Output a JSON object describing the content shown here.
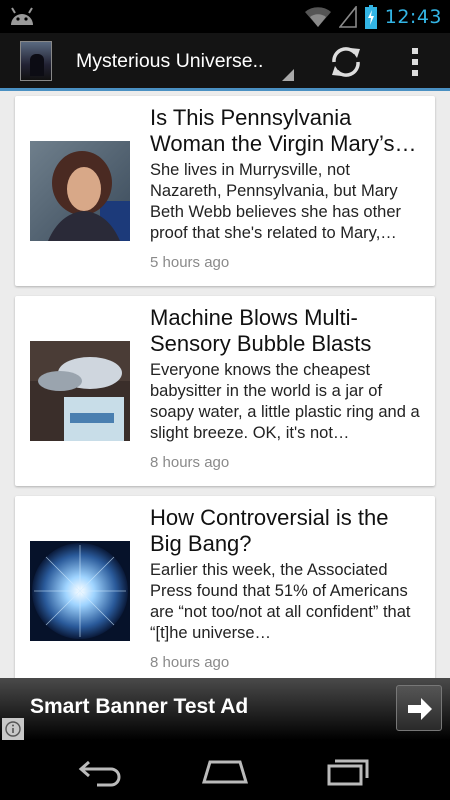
{
  "status_bar": {
    "time": "12:43",
    "icons": [
      "android-debug-icon",
      "wifi-icon",
      "signal-icon",
      "battery-charging-icon"
    ]
  },
  "action_bar": {
    "title": "Mysterious Universe..",
    "icons": [
      "app-icon",
      "refresh-icon",
      "overflow-menu-icon"
    ]
  },
  "articles": [
    {
      "title": "Is This Pennsylvania Woman the Virgin Mary’s…",
      "summary": "She lives in Murrysville, not Nazareth, Pennsylvania, but Mary Beth Webb believes she has other proof that she's related to Mary,…",
      "time": "5 hours ago"
    },
    {
      "title": "Machine Blows Multi-Sensory Bubble Blasts",
      "summary": "Everyone knows the cheapest babysitter in the world is a jar of soapy water, a little plastic ring and a slight breeze. OK, it's not…",
      "time": "8 hours ago"
    },
    {
      "title": "How Controversial is the Big Bang?",
      "summary": "Earlier this week, the Associated Press found that 51% of Americans are “not too/not at all confident” that “[t]he universe…",
      "time": "8 hours ago"
    }
  ],
  "ad": {
    "text": "Smart Banner Test Ad",
    "icons": [
      "arrow-right-icon",
      "info-icon"
    ]
  },
  "nav_bar": {
    "icons": [
      "back-icon",
      "home-icon",
      "recent-apps-icon"
    ]
  },
  "colors": {
    "accent": "#33b5e5",
    "action_bar_underline": "#4a90c2",
    "content_background": "#ececec",
    "card_background": "#ffffff",
    "timestamp": "#8a8a8a"
  }
}
